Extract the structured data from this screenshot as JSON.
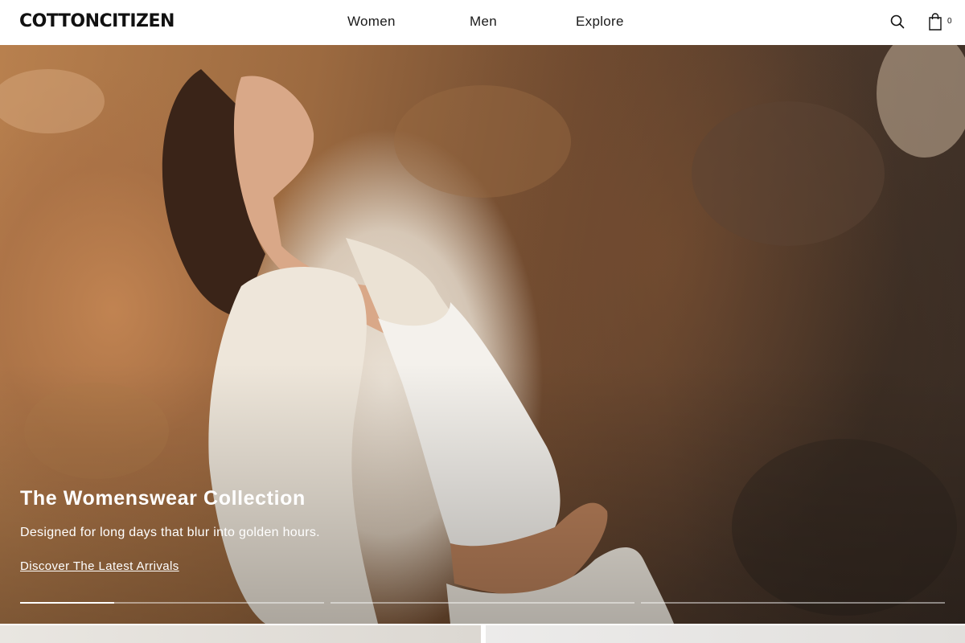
{
  "header": {
    "logo": "COTTONCITIZEN",
    "nav": {
      "women": "Women",
      "men": "Men",
      "explore": "Explore"
    },
    "search_icon": "search-icon",
    "cart_icon": "shopping-bag-icon",
    "cart_count": "0"
  },
  "hero": {
    "title": "The Womenswear Collection",
    "subtitle": "Designed for long days that blur into golden hours.",
    "cta": "Discover The Latest Arrivals",
    "slides_total": 3,
    "active_slide": 1,
    "active_slide_progress": 0.31
  },
  "colors": {
    "accent": "#111111",
    "hero_text": "#ffffff"
  }
}
